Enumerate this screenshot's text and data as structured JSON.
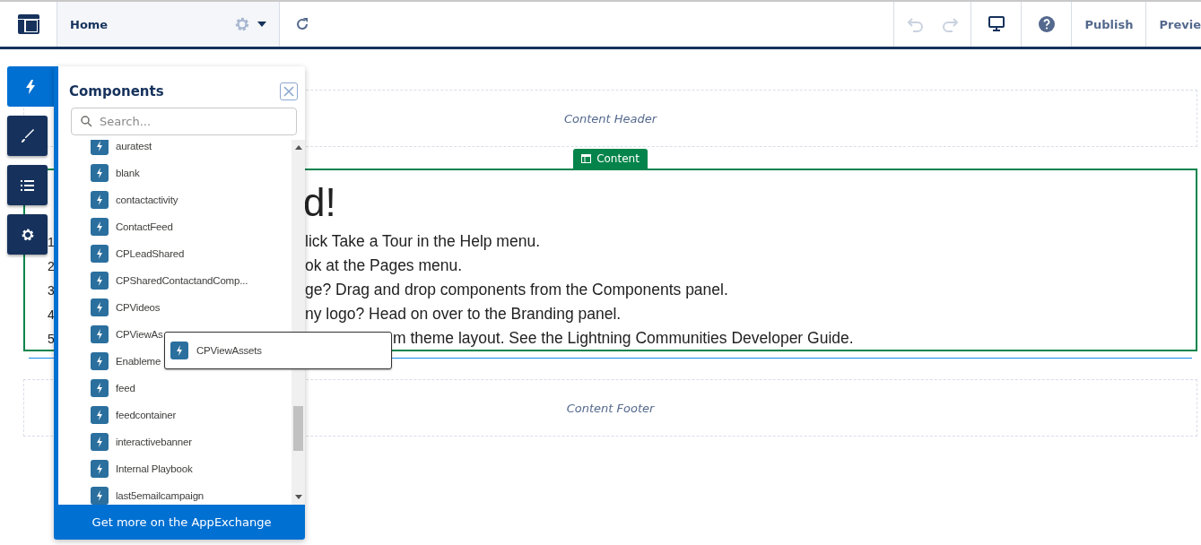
{
  "toolbar": {
    "page": "Home",
    "undo": {
      "disabled": true
    },
    "redo": {
      "disabled": true
    },
    "actions": [
      "Publish",
      "Previe"
    ]
  },
  "canvas": {
    "header": "Content Header",
    "content_tag": "Content",
    "heading_parts": [
      "d!"
    ],
    "lines": [
      {
        "number": "1",
        "text": "lick Take a Tour in the Help menu."
      },
      {
        "number": "2",
        "text": "ok at the Pages menu."
      },
      {
        "number": "3",
        "text": "ge? Drag and drop components from the Components panel."
      },
      {
        "number": "4",
        "text": "ny logo? Head on over to the Branding panel."
      },
      {
        "number": "5",
        "text": "m theme layout. See the Lightning Communities Developer Guide."
      }
    ],
    "footer": "Content Footer"
  },
  "side_tabs": [
    {
      "kind": "components",
      "selected": true
    },
    {
      "kind": "branding",
      "selected": false
    },
    {
      "kind": "pages",
      "selected": false
    },
    {
      "kind": "settings",
      "selected": false
    }
  ],
  "panel": {
    "title": "Components",
    "search": {
      "placeholder": "Search..."
    },
    "items": [
      "auratest",
      "blank",
      "contactactivity",
      "ContactFeed",
      "CPLeadShared",
      "CPSharedContactandComp...",
      "CPVideos",
      "CPViewAs",
      "Enableme",
      "feed",
      "feedcontainer",
      "interactivebanner",
      "Internal Playbook",
      "last5emailcampaign"
    ],
    "footer_link": "Get more on the AppExchange"
  },
  "drag_ghost": {
    "label": "CPViewAssets"
  }
}
